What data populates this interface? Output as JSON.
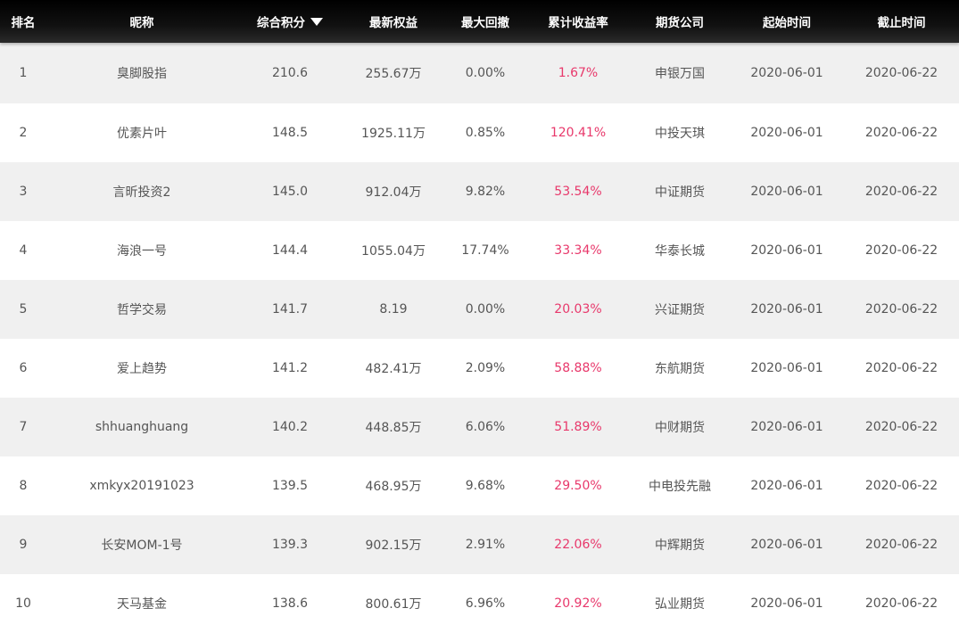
{
  "header": {
    "rank": "排名",
    "nickname": "昵称",
    "score": "综合积分",
    "sort_icon": "sort-desc-icon",
    "equity": "最新权益",
    "drawdown": "最大回撤",
    "yield": "累计收益率",
    "broker": "期货公司",
    "start": "起始时间",
    "end": "截止时间"
  },
  "colors": {
    "header_bg": "#000000",
    "stripe": "#f0f0f0",
    "yield": "#e8386b",
    "text": "#555555"
  },
  "rows": [
    {
      "rank": "1",
      "nickname": "臭脚股指",
      "score": "210.6",
      "equity": "255.67万",
      "drawdown": "0.00%",
      "yield": "1.67%",
      "broker": "申银万国",
      "start": "2020-06-01",
      "end": "2020-06-22"
    },
    {
      "rank": "2",
      "nickname": "优素片叶",
      "score": "148.5",
      "equity": "1925.11万",
      "drawdown": "0.85%",
      "yield": "120.41%",
      "broker": "中投天琪",
      "start": "2020-06-01",
      "end": "2020-06-22"
    },
    {
      "rank": "3",
      "nickname": "言昕投资2",
      "score": "145.0",
      "equity": "912.04万",
      "drawdown": "9.82%",
      "yield": "53.54%",
      "broker": "中证期货",
      "start": "2020-06-01",
      "end": "2020-06-22"
    },
    {
      "rank": "4",
      "nickname": "海浪一号",
      "score": "144.4",
      "equity": "1055.04万",
      "drawdown": "17.74%",
      "yield": "33.34%",
      "broker": "华泰长城",
      "start": "2020-06-01",
      "end": "2020-06-22"
    },
    {
      "rank": "5",
      "nickname": "哲学交易",
      "score": "141.7",
      "equity": "8.19",
      "drawdown": "0.00%",
      "yield": "20.03%",
      "broker": "兴证期货",
      "start": "2020-06-01",
      "end": "2020-06-22"
    },
    {
      "rank": "6",
      "nickname": "爱上趋势",
      "score": "141.2",
      "equity": "482.41万",
      "drawdown": "2.09%",
      "yield": "58.88%",
      "broker": "东航期货",
      "start": "2020-06-01",
      "end": "2020-06-22"
    },
    {
      "rank": "7",
      "nickname": "shhuanghuang",
      "score": "140.2",
      "equity": "448.85万",
      "drawdown": "6.06%",
      "yield": "51.89%",
      "broker": "中财期货",
      "start": "2020-06-01",
      "end": "2020-06-22"
    },
    {
      "rank": "8",
      "nickname": "xmkyx20191023",
      "score": "139.5",
      "equity": "468.95万",
      "drawdown": "9.68%",
      "yield": "29.50%",
      "broker": "中电投先融",
      "start": "2020-06-01",
      "end": "2020-06-22"
    },
    {
      "rank": "9",
      "nickname": "长安MOM-1号",
      "score": "139.3",
      "equity": "902.15万",
      "drawdown": "2.91%",
      "yield": "22.06%",
      "broker": "中辉期货",
      "start": "2020-06-01",
      "end": "2020-06-22"
    },
    {
      "rank": "10",
      "nickname": "天马基金",
      "score": "138.6",
      "equity": "800.61万",
      "drawdown": "6.96%",
      "yield": "20.92%",
      "broker": "弘业期货",
      "start": "2020-06-01",
      "end": "2020-06-22"
    }
  ]
}
